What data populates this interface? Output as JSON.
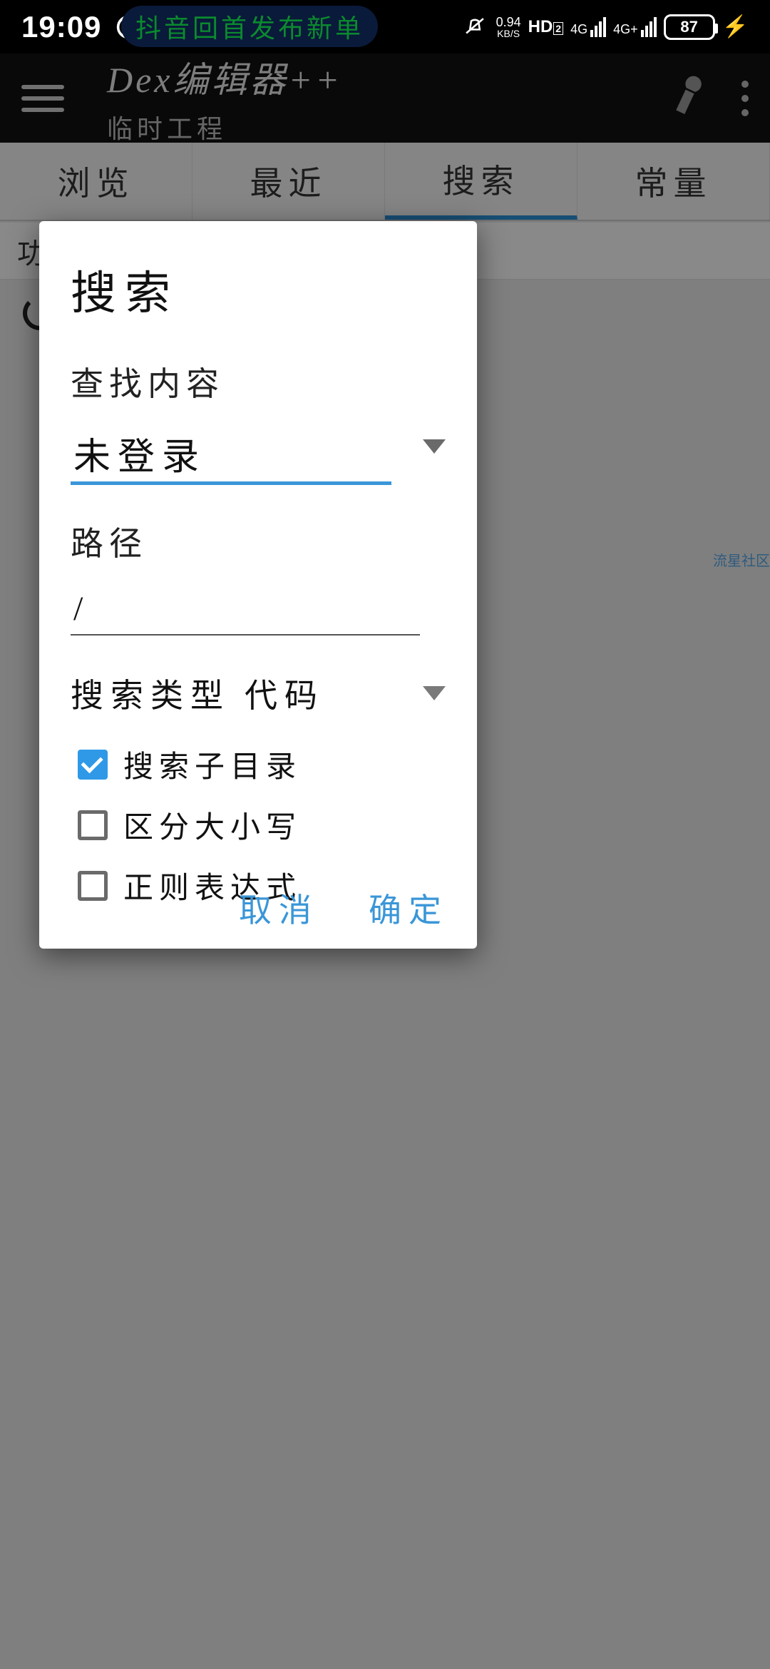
{
  "statusbar": {
    "time": "19:09",
    "banner": "抖音回首发布新单",
    "net_speed": "0.94",
    "net_unit": "KB/S",
    "hd": "HD",
    "sig1": "4G",
    "sig2": "4G+",
    "battery": "87"
  },
  "appbar": {
    "title": "Dex编辑器++",
    "subtitle": "临时工程"
  },
  "tabs": {
    "items": [
      "浏览",
      "最近",
      "搜索",
      "常量"
    ],
    "active_index": 2
  },
  "subrow": {
    "label": "功"
  },
  "dialog": {
    "title": "搜索",
    "find_label": "查找内容",
    "find_value": "未登录",
    "path_label": "路径",
    "path_value": "/",
    "type_label": "搜索类型",
    "type_value": "代码",
    "checks": [
      {
        "label": "搜索子目录",
        "checked": true
      },
      {
        "label": "区分大小写",
        "checked": false
      },
      {
        "label": "正则表达式",
        "checked": false
      }
    ],
    "cancel": "取消",
    "ok": "确定"
  },
  "watermark": "流星社区"
}
